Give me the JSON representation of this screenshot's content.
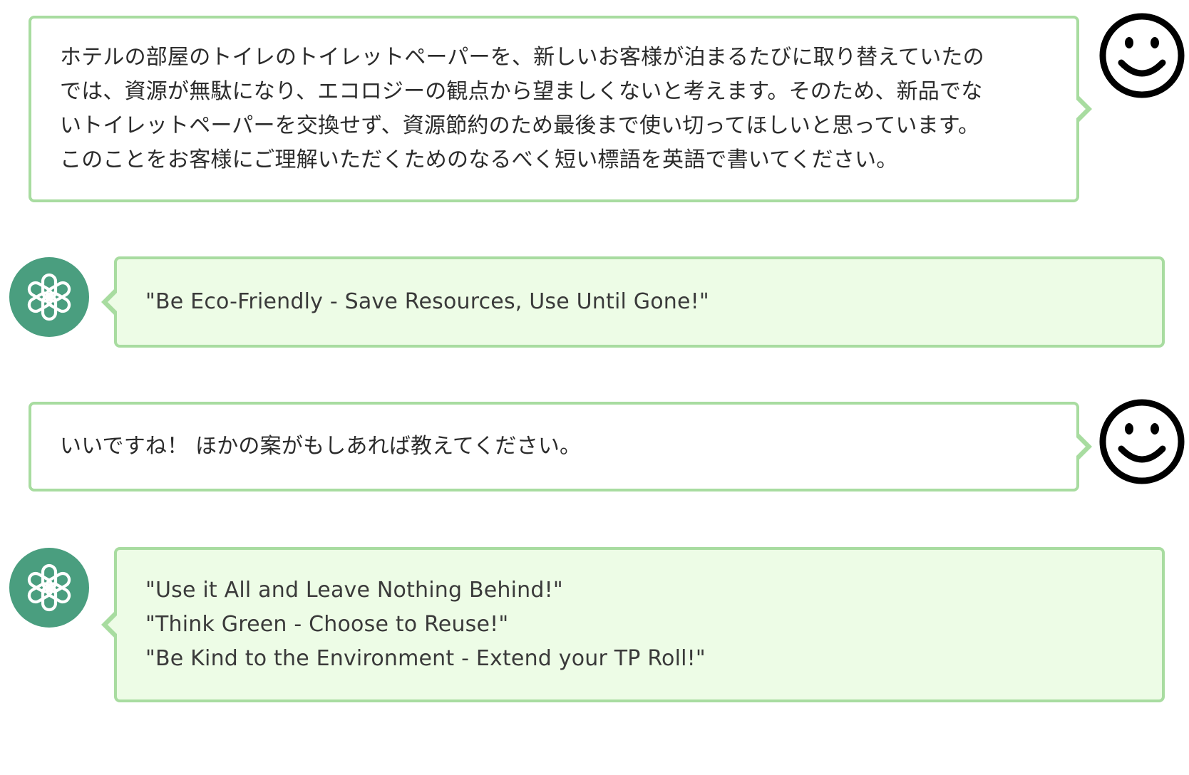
{
  "conversation": {
    "messages": [
      {
        "role": "user",
        "avatar_icon": "smiley-face-icon",
        "lines": [
          "ホテルの部屋のトイレのトイレットペーパーを、新しいお客様が泊まるたびに取り替えていたの",
          "では、資源が無駄になり、エコロジーの観点から望ましくないと考えます。そのため、新品でな",
          "いトイレットペーパーを交換せず、資源節約のため最後まで使い切ってほしいと思っています。",
          "このことをお客様にご理解いただくためのなるべく短い標語を英語で書いてください。"
        ]
      },
      {
        "role": "assistant",
        "avatar_icon": "openai-logo-icon",
        "lines": [
          "\"Be Eco-Friendly - Save Resources, Use Until Gone!\""
        ]
      },
      {
        "role": "user",
        "avatar_icon": "smiley-face-icon",
        "lines": [
          "いいですね！ ほかの案がもしあれば教えてください。"
        ]
      },
      {
        "role": "assistant",
        "avatar_icon": "openai-logo-icon",
        "lines": [
          "\"Use it All and Leave Nothing Behind!\"",
          "\"Think Green - Choose to Reuse!\"",
          "\"Be Kind to the Environment - Extend your TP Roll!\""
        ]
      }
    ]
  },
  "colors": {
    "bubble_border": "#a8dca0",
    "assistant_bubble_bg": "#edfce6",
    "user_bubble_bg": "#ffffff",
    "assistant_avatar_bg": "#4a9e7f"
  }
}
